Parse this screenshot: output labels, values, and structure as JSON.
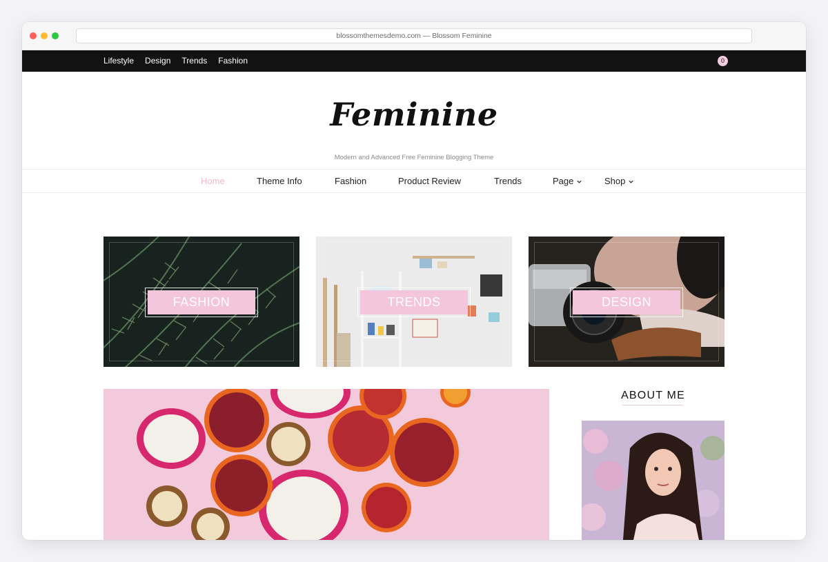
{
  "browser": {
    "url_title": "blossomthemesdemo.com — Blossom Feminine"
  },
  "top_nav": {
    "items": [
      {
        "label": "Lifestyle"
      },
      {
        "label": "Design"
      },
      {
        "label": "Trends"
      },
      {
        "label": "Fashion"
      }
    ],
    "cart_count": "0"
  },
  "header": {
    "site_title": "Feminine",
    "tagline": "Modern and Advanced Free Feminine Blogging Theme"
  },
  "main_nav": {
    "items": [
      {
        "label": "Home",
        "active": true
      },
      {
        "label": "Theme Info"
      },
      {
        "label": "Fashion"
      },
      {
        "label": "Product Review"
      },
      {
        "label": "Trends"
      },
      {
        "label": "Page",
        "has_dropdown": true
      },
      {
        "label": "Shop",
        "has_dropdown": true
      }
    ]
  },
  "categories": [
    {
      "label": "FASHION"
    },
    {
      "label": "TRENDS"
    },
    {
      "label": "DESIGN"
    }
  ],
  "sidebar": {
    "widget_title": "ABOUT ME"
  },
  "colors": {
    "accent_pink": "#f4c6dd",
    "active_nav": "#f2b8d2",
    "topbar_bg": "#121212"
  }
}
